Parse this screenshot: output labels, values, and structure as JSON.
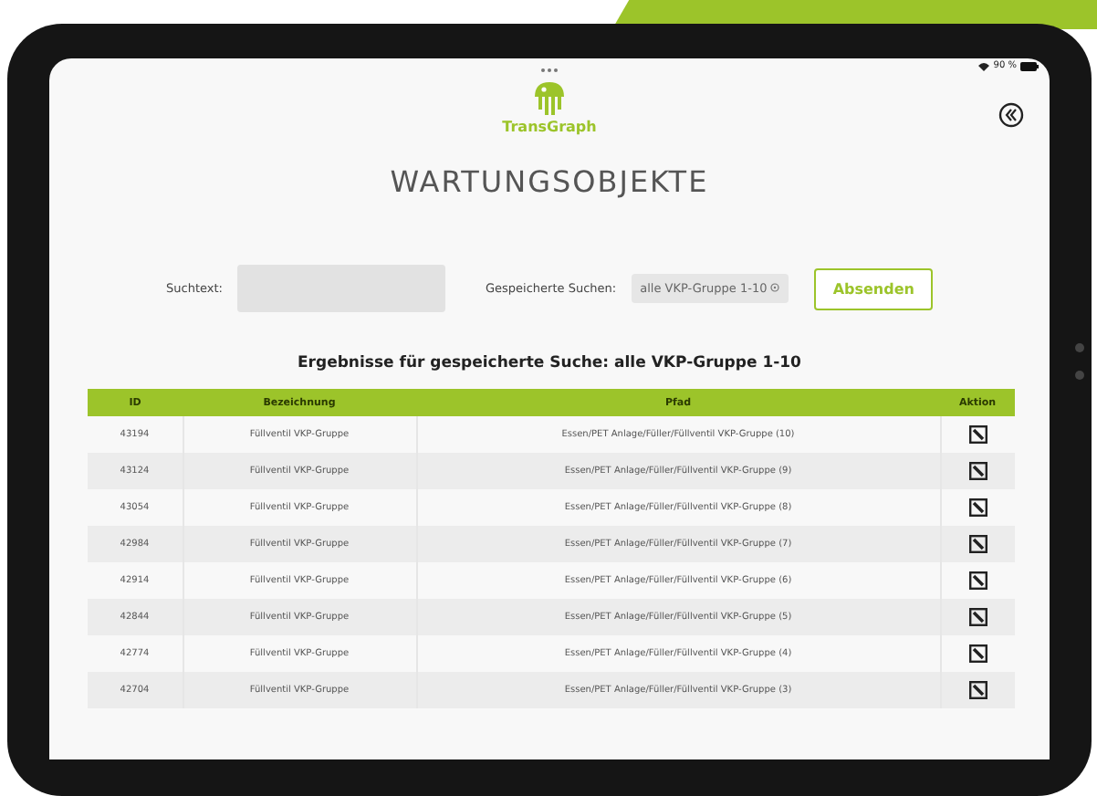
{
  "status_bar": {
    "battery": "90 %"
  },
  "header": {
    "logo_text": "TransGraph",
    "title": "WARTUNGSOBJEKTE"
  },
  "search": {
    "label": "Suchtext:",
    "saved_label": "Gespeicherte Suchen:",
    "saved_value": "alle VKP-Gruppe 1-10",
    "submit": "Absenden"
  },
  "results": {
    "heading": "Ergebnisse für gespeicherte Suche: alle VKP-Gruppe 1-10",
    "columns": [
      "ID",
      "Bezeichnung",
      "Pfad",
      "Aktion"
    ],
    "rows": [
      {
        "id": "43194",
        "name": "Füllventil VKP-Gruppe",
        "path": "Essen/PET Anlage/Füller/Füllventil VKP-Gruppe (10)"
      },
      {
        "id": "43124",
        "name": "Füllventil VKP-Gruppe",
        "path": "Essen/PET Anlage/Füller/Füllventil VKP-Gruppe (9)"
      },
      {
        "id": "43054",
        "name": "Füllventil VKP-Gruppe",
        "path": "Essen/PET Anlage/Füller/Füllventil VKP-Gruppe (8)"
      },
      {
        "id": "42984",
        "name": "Füllventil VKP-Gruppe",
        "path": "Essen/PET Anlage/Füller/Füllventil VKP-Gruppe (7)"
      },
      {
        "id": "42914",
        "name": "Füllventil VKP-Gruppe",
        "path": "Essen/PET Anlage/Füller/Füllventil VKP-Gruppe (6)"
      },
      {
        "id": "42844",
        "name": "Füllventil VKP-Gruppe",
        "path": "Essen/PET Anlage/Füller/Füllventil VKP-Gruppe (5)"
      },
      {
        "id": "42774",
        "name": "Füllventil VKP-Gruppe",
        "path": "Essen/PET Anlage/Füller/Füllventil VKP-Gruppe (4)"
      },
      {
        "id": "42704",
        "name": "Füllventil VKP-Gruppe",
        "path": "Essen/PET Anlage/Füller/Füllventil VKP-Gruppe (3)"
      }
    ]
  }
}
